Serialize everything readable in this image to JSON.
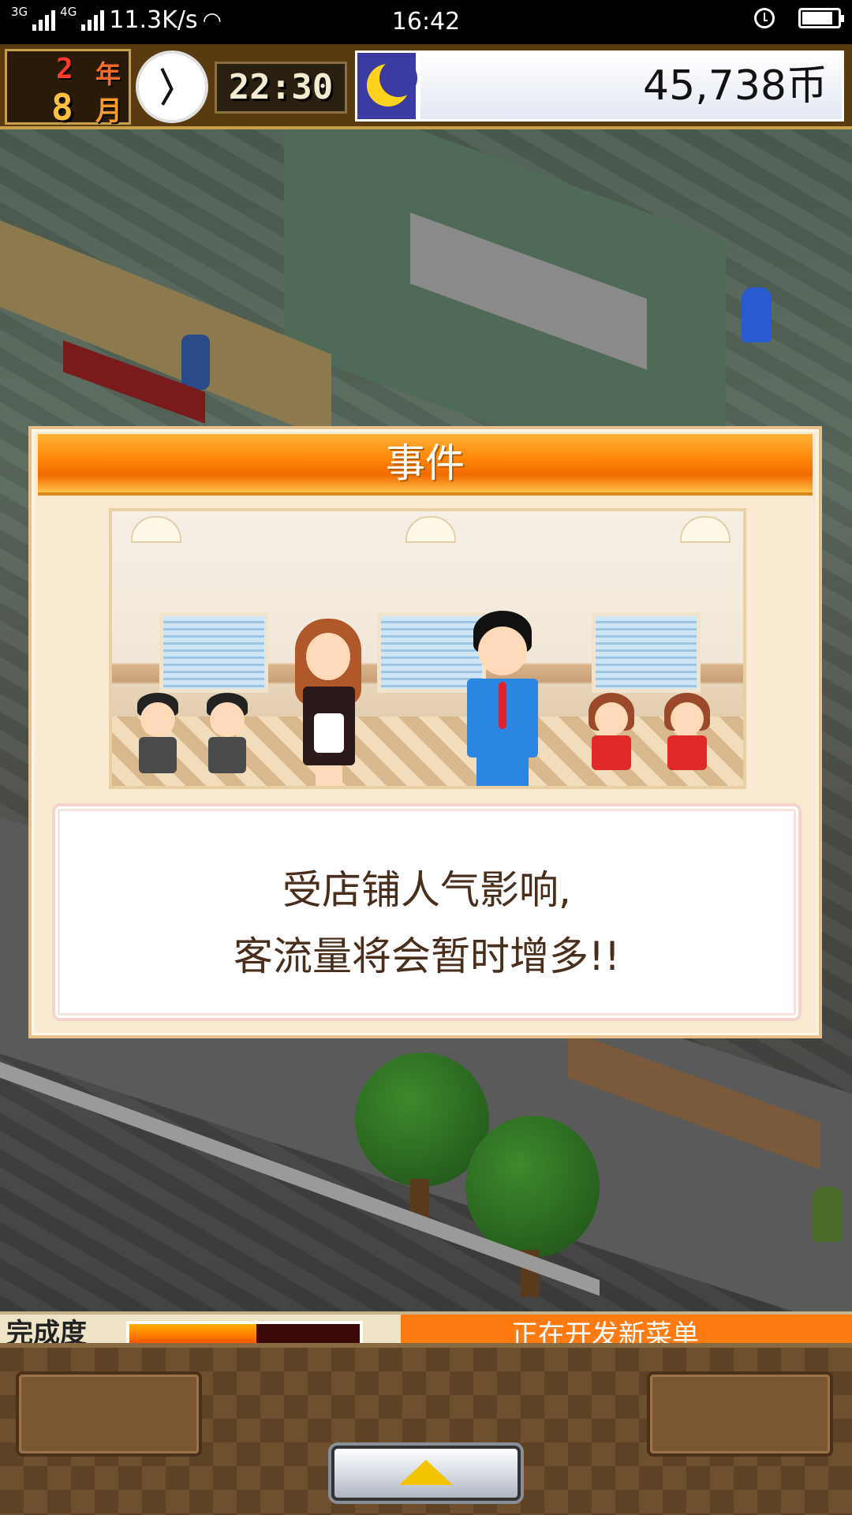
{
  "status_bar": {
    "net_type_1": "3G",
    "net_type_2": "4G",
    "speed": "11.3K/s",
    "time": "16:42"
  },
  "hud": {
    "year_num": "2",
    "year_char": "年",
    "month_num": "8",
    "month_char": "月",
    "game_time": "22:30",
    "money": "45,738币",
    "day_phase_icon": "moon-icon"
  },
  "event_dialog": {
    "title": "事件",
    "message_line1": "受店铺人气影响,",
    "message_line2": "客流量将会暂时增多!!"
  },
  "bottom": {
    "strip_label": "完成度",
    "gauge_level": 0.55,
    "notice_text": "正在开发新菜单"
  },
  "colors": {
    "dialog_header": "#ff8a0a",
    "dialog_bg": "#fbead2",
    "money_bg": "#ffffff",
    "panel_bg": "#6e4f2e"
  }
}
